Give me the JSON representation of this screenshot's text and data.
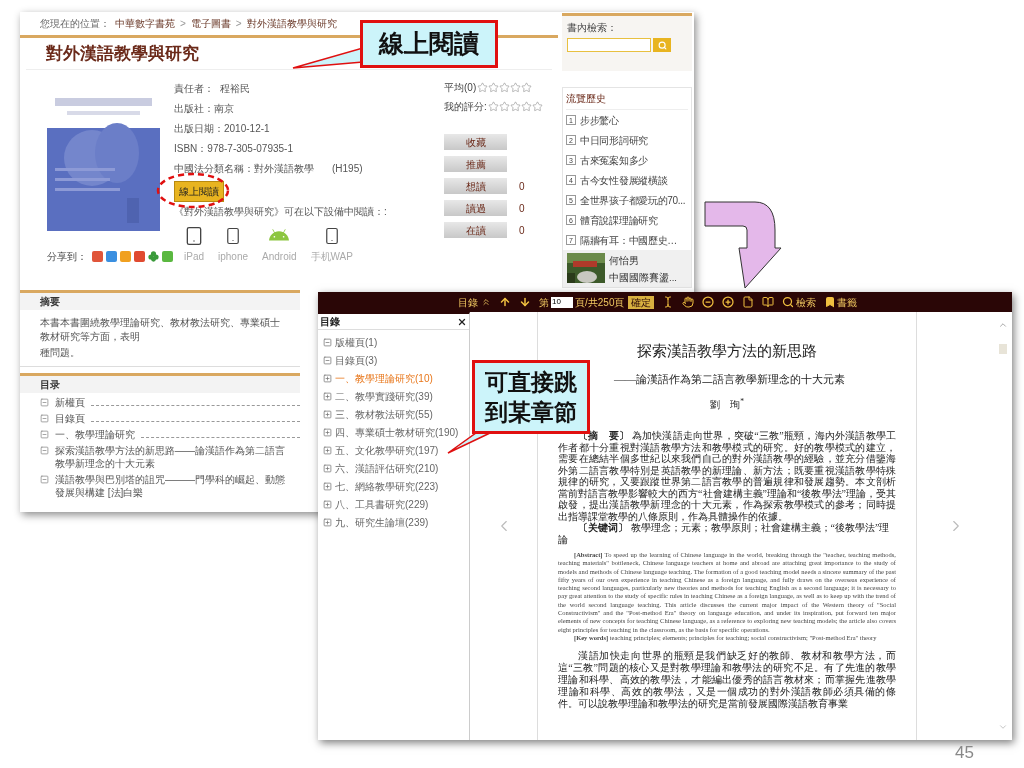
{
  "book_page": {
    "breadcrumb": {
      "label": "您現在的位置：",
      "separator": ">",
      "items": [
        "中華數字書苑",
        "電子圖書",
        "對外漢語教學與研究"
      ]
    },
    "title": "對外漢語教學與研究",
    "details": [
      {
        "text": "責任者：  程裕民"
      },
      {
        "text": "出版社：南京"
      },
      {
        "text": "出版日期：2010-12-1"
      },
      {
        "text": "ISBN：978-7-305-07935-1"
      },
      {
        "text": "中國法分類名稱：對外漢語教學",
        "code": "(H195)"
      }
    ],
    "read_online_button": "線上閱讀",
    "devices_note": "《對外漢語教學與研究》可在以下設備中閱讀：:",
    "devices": [
      {
        "label": "iPad",
        "kind": "tablet"
      },
      {
        "label": "iphone",
        "kind": "phone"
      },
      {
        "label": "Android",
        "kind": "android"
      },
      {
        "label": "手机WAP",
        "kind": "phone"
      }
    ],
    "share": {
      "label": "分享到：",
      "sites": [
        {
          "kind": "square",
          "color": "#e0553a"
        },
        {
          "kind": "square",
          "color": "#3a8fe0"
        },
        {
          "kind": "square",
          "color": "#f0a020"
        },
        {
          "kind": "square",
          "color": "#e04a30"
        },
        {
          "kind": "clover",
          "color": "#3a9a3a"
        },
        {
          "kind": "square",
          "color": "#5ab840"
        }
      ]
    },
    "ratings": [
      {
        "label": "平均(0)",
        "stars": 0
      },
      {
        "label": "我的評分:",
        "stars": 0
      }
    ],
    "actions": [
      {
        "label": "收藏"
      },
      {
        "label": "推薦"
      },
      {
        "label": "想讀",
        "count": "0"
      },
      {
        "label": "讀過",
        "count": "0"
      },
      {
        "label": "在讀",
        "count": "0"
      }
    ],
    "search": {
      "label": "書內檢索："
    },
    "history": {
      "title": "流覽歷史",
      "items": [
        {
          "number": "1",
          "title": "步步驚心"
        },
        {
          "number": "2",
          "title": "中日同形詞研究"
        },
        {
          "number": "3",
          "title": "古來冤案知多少"
        },
        {
          "number": "4",
          "title": "古今女性發展縱橫談"
        },
        {
          "number": "5",
          "title": "全世界孩子都愛玩的70..."
        },
        {
          "number": "6",
          "title": "體育說課理論研究"
        },
        {
          "number": "7",
          "title": "隔牆有耳：中國歷史…"
        }
      ],
      "featured": {
        "author": "何怡男",
        "title": "中國國際賽盪..."
      }
    },
    "abstract": {
      "title": "摘要",
      "lines": [
        "本書本書圍繞教學理論研究、教材教法研究、專業碩士教材研究等方面，表明",
        "種問題。"
      ]
    },
    "contents": {
      "title": "目录",
      "items": [
        {
          "title": "新權頁"
        },
        {
          "title": "目錄頁"
        },
        {
          "title": "一、教學理論研究"
        },
        {
          "title": "探索漢語教學方法的新思路——論漢語作為第二語言教學新理念的十大元素"
        },
        {
          "title": "漢語教學與巴別塔的詛咒———門學科的崛起、動態發展與構建 [法]白樂"
        }
      ]
    }
  },
  "reader": {
    "toolbar": {
      "toc": "目錄",
      "page_prefix": "第",
      "page": "10",
      "page_suffix": "頁/共250頁",
      "confirm": "確定",
      "search": "檢索",
      "bookmark": "書籤"
    },
    "toc": {
      "title": "目錄",
      "items": [
        {
          "label": "版權頁(1)",
          "expanded": true,
          "selected": false
        },
        {
          "label": "目錄頁(3)",
          "expanded": true,
          "selected": false
        },
        {
          "label": "一、教學理論研究(10)",
          "expanded": false,
          "selected": true
        },
        {
          "label": "二、教學實踐研究(39)",
          "expanded": false,
          "selected": false
        },
        {
          "label": "三、教材教法研究(55)",
          "expanded": false,
          "selected": false
        },
        {
          "label": "四、專業碩士教材研究(190)",
          "expanded": false,
          "selected": false
        },
        {
          "label": "五、文化教學研究(197)",
          "expanded": false,
          "selected": false
        },
        {
          "label": "六、漢語評估研究(210)",
          "expanded": false,
          "selected": false
        },
        {
          "label": "七、網絡教學研究(223)",
          "expanded": false,
          "selected": false
        },
        {
          "label": "八、工具書研究(229)",
          "expanded": false,
          "selected": false
        },
        {
          "label": "九、研究生論壇(239)",
          "expanded": false,
          "selected": false
        }
      ]
    },
    "page": {
      "title": "探索漢語教學方法的新思路",
      "subtitle": "——論漢語作為第二語言教學新理念的十大元素",
      "author": "劉　珣$^{*}$",
      "abstract_zh": "**〔摘　要〕** 為加快漢語走向世界，突破“三教”瓶頸，海內外漢語教學工作者都十分重視對漢語教學方法和教學模式的研究。好的教學模式的建立，需要在總結半個多世紀以來我們自己的對外漢語教學的經驗，並充分借鑒海外第二語言教學特別是英語教學的新理論、新方法；既要重視漢語教學特殊規律的研究，又要跟蹤世界第二語言教學的普遍規律和發展趨勢。本文剖析當前對語言教學影響較大的西方“社會建構主義”理論和“後教學法”理論，受其啟發，提出漢語教學新理念的十大元素，作為探索教學模式的參考；同時提出指導課堂教學的八條原則，作為具體操作的依據。",
      "keywords_zh": "**〔关键词〕** 教學理念；元素；教學原則；社會建構主義；“後教學法”理論",
      "abstract_en": "**[Abstract]** To speed up the learning of Chinese language in the world, breaking through the \"teacher, teaching methods, teaching materials\" bottleneck, Chinese language teachers at home and abroad are attaching great importance to the study of models and methods of Chinese language teaching. The formation of a good teaching model needs a sincere summary of the past fifty years of our own experience in teaching Chinese as a foreign language, and fully draws on the overseas experience of teaching second languages, particularly new theories and methods for teaching English as a second language; it is necessary to pay great attention to the study of specific rules in teaching Chinese as a foreign language, as well as to keep up with the trend of the world second language teaching. This article discusses the current major impact of the Western theory of \"Social Constructivism\" and the \"Post-method Era\" theory on language education, and under its inspiration, put forward ten major elements of new concepts for teaching Chinese language, as a reference to exploring new teaching models; the article also covers eight principles for teaching in the classroom, as the basis for specific operations.",
      "keywords_en": "**[Key words]** teaching principles; elements; principles for teaching; social constructivism; \"Post-method Era\" theory",
      "body": "漢語加快走向世界的瓶頸是我們缺乏好的教師、教材和教學方法，而這“三教”問題的核心又是對教學理論和教學法的研究不足。有了先進的教學理論和科學、高效的教學法，才能編出優秀的語言教材來；而掌握先進教學理論和科學、高效的教學法，又是一個成功的對外漢語教師必須具備的條件。可以說教學理論和教學法的研究是當前發展國際漢語教育事業"
    }
  },
  "callouts": [
    {
      "text": "線上閱讀"
    },
    {
      "text": "可直接跳到某章節"
    }
  ],
  "slide_number": "45"
}
